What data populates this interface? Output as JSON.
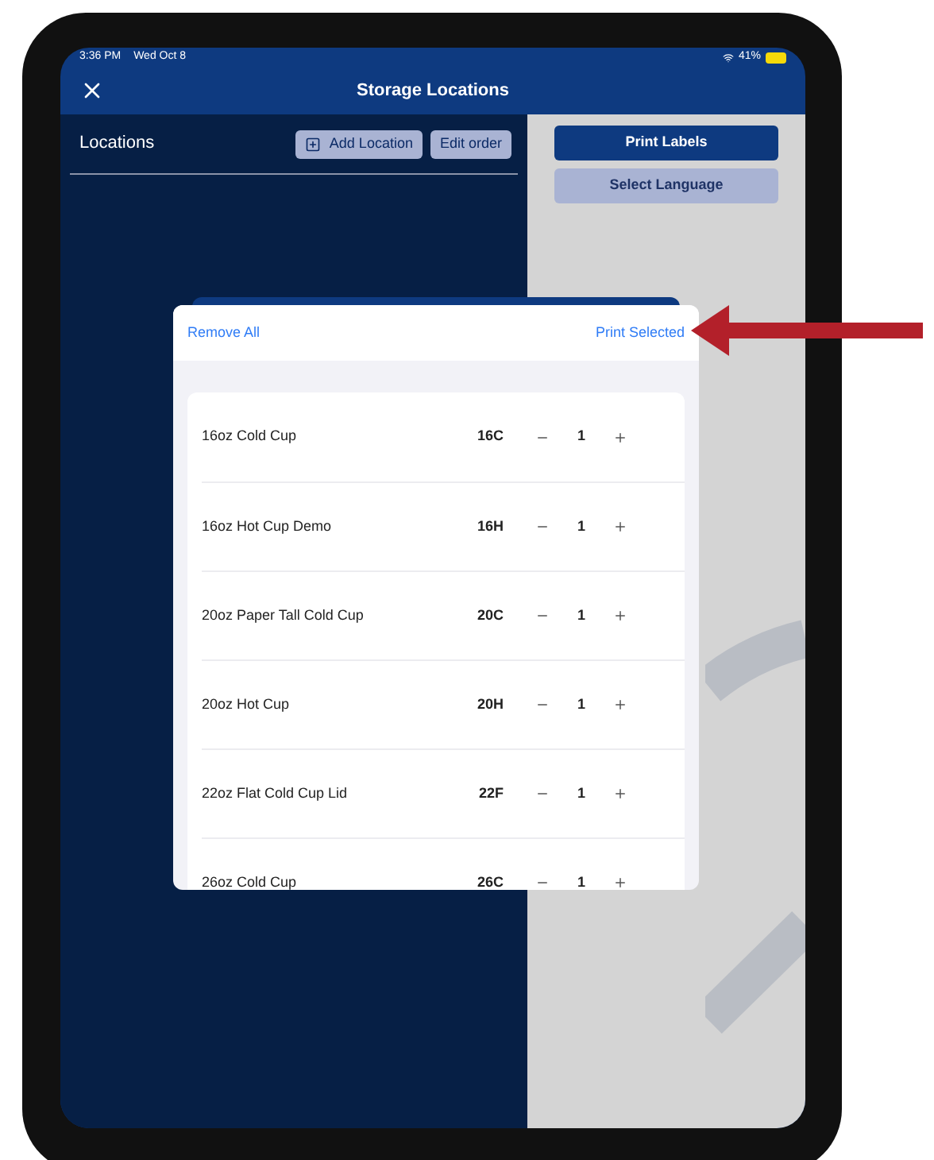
{
  "status_bar": {
    "time": "3:36 PM",
    "date": "Wed Oct 8",
    "battery": "41%"
  },
  "nav": {
    "title": "Storage Locations"
  },
  "locations": {
    "title": "Locations",
    "buttons": [
      {
        "label": "Add Location",
        "kind": "add"
      },
      {
        "label": "Edit order",
        "kind": "plain"
      }
    ]
  },
  "side_buttons": [
    {
      "label": "Print Labels",
      "kind": "primary"
    },
    {
      "label": "Select Language",
      "kind": "secondary"
    }
  ],
  "modal": {
    "left_action": "Remove All",
    "right_action": "Print Selected",
    "items": [
      {
        "name": "16oz Cold Cup",
        "code": "16C",
        "quantity": "1"
      },
      {
        "name": "16oz Hot Cup Demo",
        "code": "16H",
        "quantity": "1"
      },
      {
        "name": "20oz Paper Tall Cold Cup",
        "code": "20C",
        "quantity": "1"
      },
      {
        "name": "20oz Hot Cup",
        "code": "20H",
        "quantity": "1"
      },
      {
        "name": "22oz Flat Cold Cup Lid",
        "code": "22F",
        "quantity": "1"
      },
      {
        "name": "26oz Cold Cup",
        "code": "26C",
        "quantity": "1"
      }
    ]
  }
}
